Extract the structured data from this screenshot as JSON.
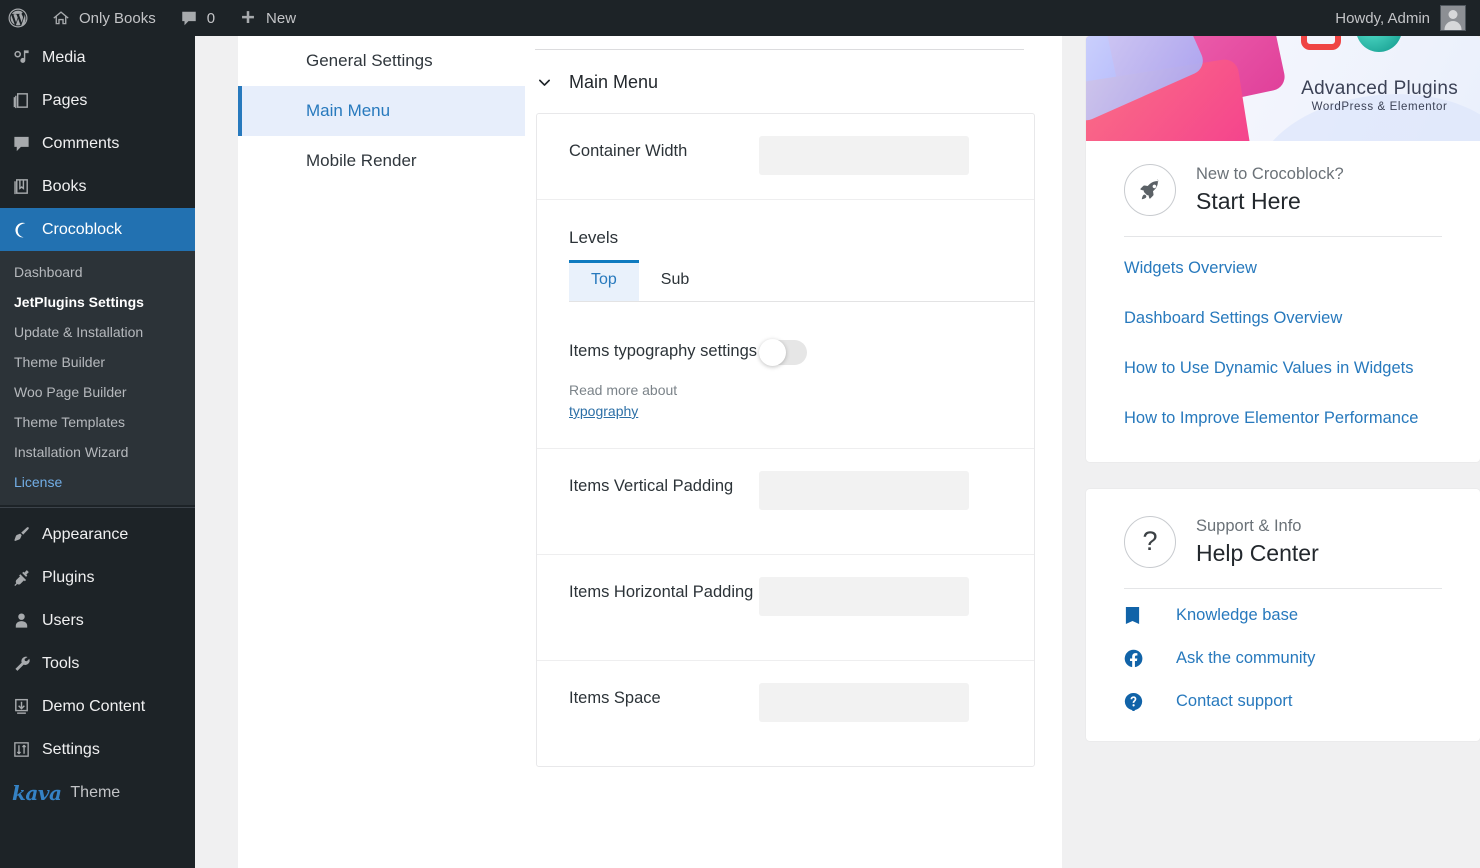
{
  "adminbar": {
    "wp_logo": "wordpress-logo",
    "site_name": "Only Books",
    "comments_count": "0",
    "new_label": "New",
    "howdy": "Howdy, Admin"
  },
  "adminmenu": {
    "items": [
      {
        "label": "Media",
        "icon": "media-icon"
      },
      {
        "label": "Pages",
        "icon": "pages-icon"
      },
      {
        "label": "Comments",
        "icon": "comments-icon"
      },
      {
        "label": "Books",
        "icon": "book-icon"
      },
      {
        "label": "Crocoblock",
        "icon": "crocoblock-icon",
        "current": true
      }
    ],
    "submenu": [
      {
        "label": "Dashboard"
      },
      {
        "label": "JetPlugins Settings",
        "current": true
      },
      {
        "label": "Update & Installation"
      },
      {
        "label": "Theme Builder"
      },
      {
        "label": "Woo Page Builder"
      },
      {
        "label": "Theme Templates"
      },
      {
        "label": "Installation Wizard"
      },
      {
        "label": "License",
        "license": true
      }
    ],
    "items2": [
      {
        "label": "Appearance",
        "icon": "brush-icon"
      },
      {
        "label": "Plugins",
        "icon": "plug-icon"
      },
      {
        "label": "Users",
        "icon": "user-icon"
      },
      {
        "label": "Tools",
        "icon": "wrench-icon"
      },
      {
        "label": "Demo Content",
        "icon": "download-box-icon"
      },
      {
        "label": "Settings",
        "icon": "sliders-icon"
      }
    ],
    "theme": {
      "logo": "kava",
      "label": "Theme"
    }
  },
  "nav": {
    "items": [
      {
        "label": "General Settings",
        "active": false
      },
      {
        "label": "Main Menu",
        "active": true
      },
      {
        "label": "Mobile Render",
        "active": false
      }
    ]
  },
  "main": {
    "accordion_title": "Main Menu",
    "chevron": "chevron-down-icon",
    "container_width": {
      "label": "Container Width",
      "value": ""
    },
    "levels_title": "Levels",
    "tabs": [
      {
        "label": "Top",
        "active": true
      },
      {
        "label": "Sub",
        "active": false
      }
    ],
    "typography": {
      "label": "Items typography settings",
      "toggle_on": false,
      "desc_prefix": "Read more about ",
      "desc_link": "typography"
    },
    "fields": [
      {
        "label": "Items Vertical Padding",
        "value": ""
      },
      {
        "label": "Items Horizontal Padding",
        "value": ""
      },
      {
        "label": "Items Space",
        "value": ""
      }
    ]
  },
  "sidebar": {
    "banner": {
      "title": "Advanced Plugins",
      "subtitle": "WordPress & Elementor"
    },
    "start_card": {
      "icon": "rocket-icon",
      "eyebrow": "New to Crocoblock?",
      "title": "Start Here",
      "links": [
        "Widgets Overview",
        "Dashboard Settings Overview",
        "How to Use Dynamic Values in Widgets",
        "How to Improve Elementor Performance"
      ]
    },
    "help_card": {
      "icon": "question-circle-icon",
      "eyebrow": "Support & Info",
      "title": "Help Center",
      "links": [
        {
          "label": "Knowledge base",
          "icon": "book-icon"
        },
        {
          "label": "Ask the community",
          "icon": "facebook-icon"
        },
        {
          "label": "Contact support",
          "icon": "question-mark-icon"
        }
      ]
    }
  },
  "colors": {
    "admin_dark": "#1d2327",
    "submenu_dark": "#2c3338",
    "accent_blue": "#2271b1",
    "link_blue": "#2779bd",
    "active_tab_bg": "#e9f1fb",
    "workspace_gray": "#f0f0f1"
  }
}
